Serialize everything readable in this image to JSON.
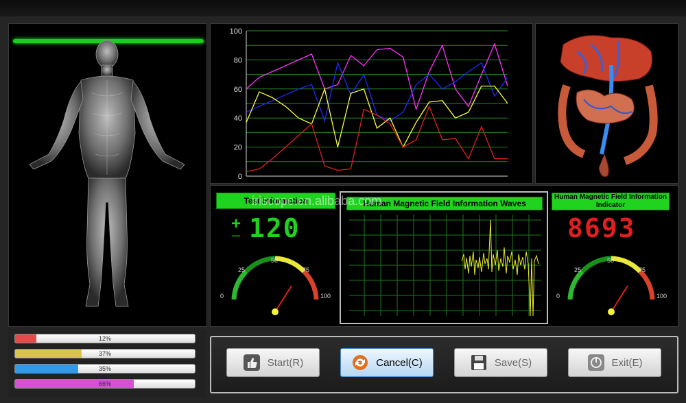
{
  "chart": {
    "yticks": [
      "100",
      "80",
      "60",
      "40",
      "20",
      "0"
    ],
    "ylim": [
      0,
      100
    ]
  },
  "chart_data": {
    "type": "line",
    "ylim": [
      0,
      100
    ],
    "grid": true,
    "series": [
      {
        "color": "#ff33ff",
        "values": [
          60,
          68,
          72,
          76,
          80,
          84,
          60,
          63,
          83,
          76,
          87,
          88,
          82,
          46,
          72,
          90,
          60,
          48,
          70,
          91,
          62
        ]
      },
      {
        "color": "#1e2bff",
        "values": [
          44,
          48,
          52,
          56,
          60,
          63,
          38,
          78,
          56,
          70,
          42,
          38,
          44,
          63,
          70,
          60,
          65,
          72,
          78,
          55,
          68
        ]
      },
      {
        "color": "#ffff33",
        "values": [
          37,
          58,
          54,
          48,
          40,
          36,
          60,
          20,
          57,
          60,
          33,
          40,
          20,
          37,
          51,
          52,
          40,
          44,
          62,
          62,
          50
        ]
      },
      {
        "color": "#e02020",
        "values": [
          3,
          5,
          12,
          20,
          28,
          36,
          7,
          4,
          5,
          46,
          42,
          36,
          20,
          25,
          48,
          25,
          26,
          12,
          34,
          12,
          12
        ]
      }
    ]
  },
  "indicators": {
    "left": {
      "label": "Test Information",
      "sign": "+",
      "value": "120"
    },
    "center": {
      "label": "Human Magnetic Field Information Waves"
    },
    "right": {
      "label": "Human Magnetic Field Information Indicator",
      "value": "8693"
    },
    "gauge_ticks": {
      "t0": "0",
      "t25": "25",
      "t50": "50",
      "t75": "75",
      "t100": "100"
    }
  },
  "watermark": "iriscope.en.alibaba.com",
  "progress_bars": [
    {
      "label": "12%",
      "value": 0.12,
      "color": "#e34a4a"
    },
    {
      "label": "37%",
      "value": 0.37,
      "color": "#d8c34c"
    },
    {
      "label": "35%",
      "value": 0.35,
      "color": "#3399e6"
    },
    {
      "label": "66%",
      "value": 0.66,
      "color": "#d64fd6"
    }
  ],
  "buttons": {
    "start": "Start(R)",
    "cancel": "Cancel(C)",
    "save": "Save(S)",
    "exit": "Exit(E)"
  },
  "icons": {
    "start": "thumbs-up-icon",
    "cancel": "refresh-icon",
    "save": "floppy-disk-icon",
    "exit": "power-icon"
  }
}
